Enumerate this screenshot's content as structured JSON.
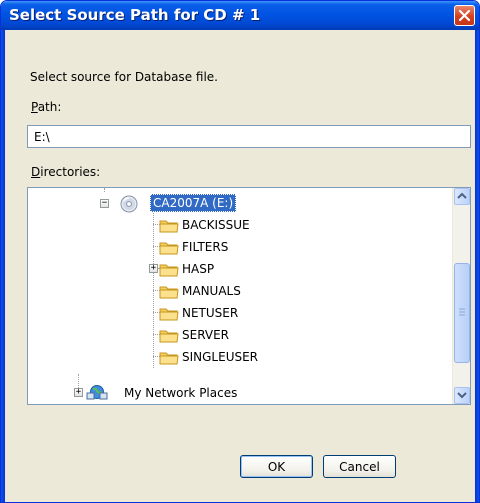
{
  "window": {
    "title": "Select Source Path for CD # 1",
    "close_icon": "close-icon"
  },
  "dialog": {
    "prompt": "Select source for Database file.",
    "path_label_first": "P",
    "path_label_rest": "ath:",
    "path_value": "E:\\",
    "dirs_label_first": "D",
    "dirs_label_rest": "irectories:"
  },
  "tree": {
    "drive": {
      "label": "CA2007A (E:)",
      "icon": "cd-drive-icon",
      "expanded": true,
      "selected": true
    },
    "folders": [
      {
        "label": "BACKISSUE",
        "icon": "folder-icon",
        "has_children": false
      },
      {
        "label": "FILTERS",
        "icon": "folder-icon",
        "has_children": false
      },
      {
        "label": "HASP",
        "icon": "folder-icon",
        "has_children": true
      },
      {
        "label": "MANUALS",
        "icon": "folder-icon",
        "has_children": false
      },
      {
        "label": "NETUSER",
        "icon": "folder-icon",
        "has_children": false
      },
      {
        "label": "SERVER",
        "icon": "folder-icon",
        "has_children": false
      },
      {
        "label": "SINGLEUSER",
        "icon": "folder-icon",
        "has_children": false
      }
    ],
    "network": {
      "label": "My Network Places",
      "icon": "network-places-icon",
      "has_children": true
    }
  },
  "buttons": {
    "ok": "OK",
    "cancel": "Cancel"
  },
  "colors": {
    "titlebar": "#0054e3",
    "selection": "#316ac5",
    "close_button": "#d5401f",
    "dialog_face": "#ece9d8"
  }
}
